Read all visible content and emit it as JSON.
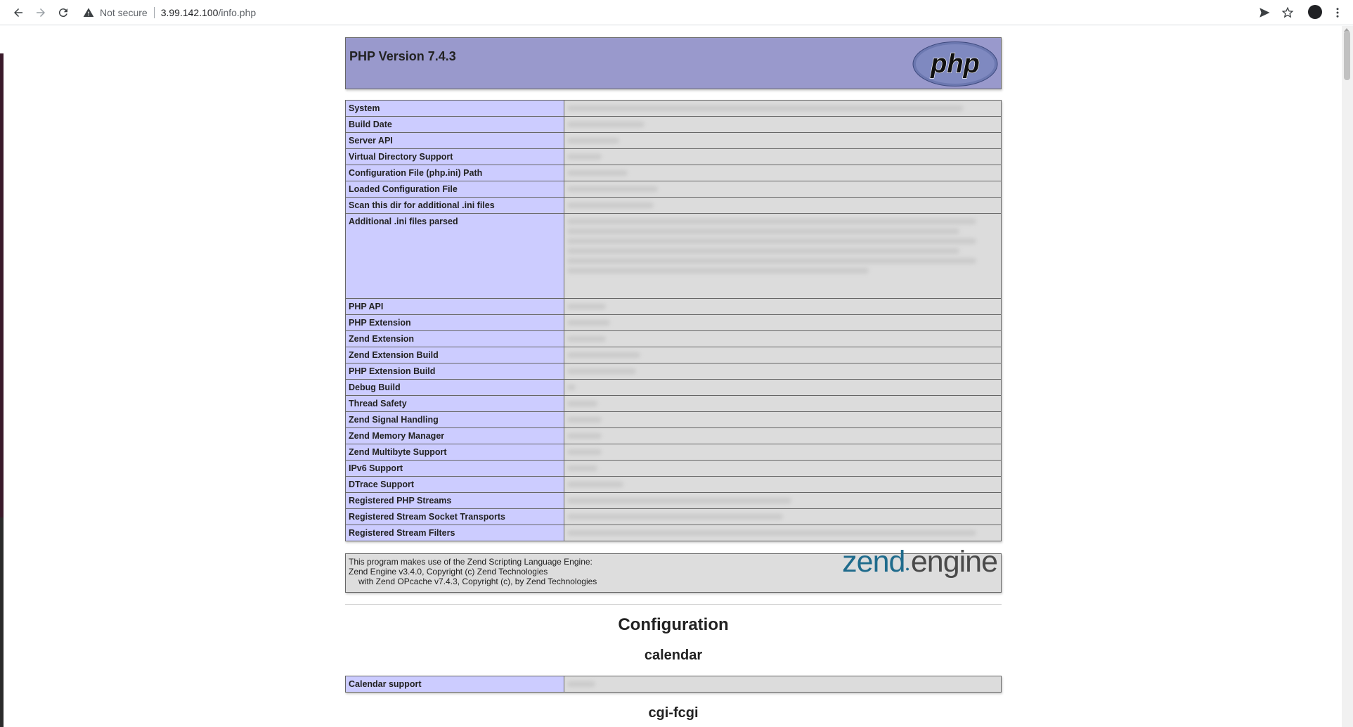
{
  "browser": {
    "security_label": "Not secure",
    "url_host": "3.99.142.100",
    "url_path": "/info.php"
  },
  "header": {
    "title": "PHP Version 7.4.3",
    "logo_text": "php"
  },
  "info_rows": [
    "System",
    "Build Date",
    "Server API",
    "Virtual Directory Support",
    "Configuration File (php.ini) Path",
    "Loaded Configuration File",
    "Scan this dir for additional .ini files",
    "Additional .ini files parsed",
    "PHP API",
    "PHP Extension",
    "Zend Extension",
    "Zend Extension Build",
    "PHP Extension Build",
    "Debug Build",
    "Thread Safety",
    "Zend Signal Handling",
    "Zend Memory Manager",
    "Zend Multibyte Support",
    "IPv6 Support",
    "DTrace Support",
    "Registered PHP Streams",
    "Registered Stream Socket Transports",
    "Registered Stream Filters"
  ],
  "zend": {
    "line1": "This program makes use of the Zend Scripting Language Engine:",
    "line2": "Zend Engine v3.4.0, Copyright (c) Zend Technologies",
    "line3": "with Zend OPcache v7.4.3, Copyright (c), by Zend Technologies",
    "logo_part1": "zend",
    "logo_part2": "engine"
  },
  "configuration": {
    "title": "Configuration",
    "sections": [
      {
        "name": "calendar",
        "rows": [
          "Calendar support"
        ]
      },
      {
        "name": "cgi-fcgi"
      }
    ]
  }
}
